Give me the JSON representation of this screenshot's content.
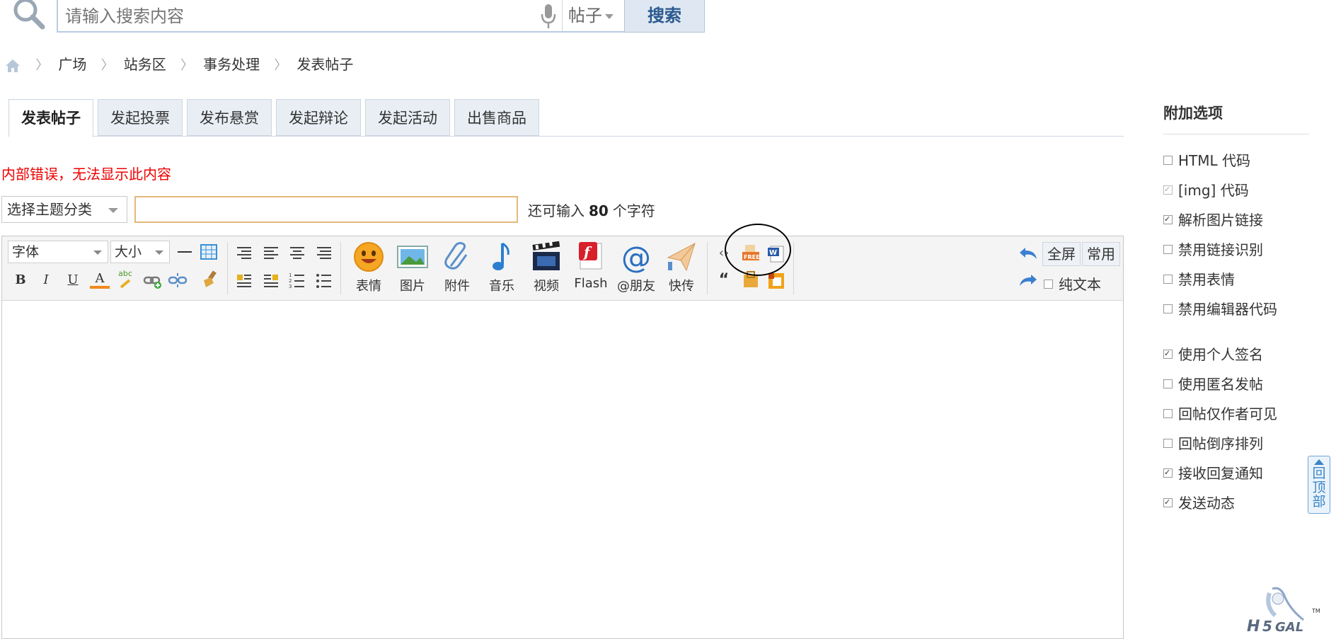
{
  "search": {
    "placeholder": "请输入搜索内容",
    "type": "帖子",
    "button_label": "搜索"
  },
  "breadcrumb": [
    "广场",
    "站务区",
    "事务处理",
    "发表帖子"
  ],
  "tabs": [
    {
      "label": "发表帖子",
      "active": true
    },
    {
      "label": "发起投票",
      "active": false
    },
    {
      "label": "发布悬赏",
      "active": false
    },
    {
      "label": "发起辩论",
      "active": false
    },
    {
      "label": "发起活动",
      "active": false
    },
    {
      "label": "出售商品",
      "active": false
    }
  ],
  "error_message": "内部错误，无法显示此内容",
  "subject": {
    "category_placeholder": "选择主题分类",
    "remaining_prefix": "还可输入",
    "remaining_count": "80",
    "remaining_suffix": "个字符"
  },
  "editor": {
    "font_select": "字体",
    "size_select": "大小",
    "format_buttons": {
      "bold": "B",
      "italic": "I",
      "underline": "U",
      "font_color": "A",
      "spellcheck": "abc"
    },
    "insert_buttons": [
      {
        "label": "表情",
        "icon": "smiley-icon"
      },
      {
        "label": "图片",
        "icon": "image-icon"
      },
      {
        "label": "附件",
        "icon": "paperclip-icon"
      },
      {
        "label": "音乐",
        "icon": "music-note-icon"
      },
      {
        "label": "视频",
        "icon": "video-clapper-icon"
      },
      {
        "label": "Flash",
        "icon": "flash-icon"
      },
      {
        "label": "@朋友",
        "icon": "at-icon"
      },
      {
        "label": "快传",
        "icon": "paper-plane-icon"
      }
    ],
    "fullscreen_label": "全屏",
    "common_label": "常用",
    "plain_text_label": "纯文本"
  },
  "sidebar": {
    "title": "附加选项",
    "options": [
      {
        "label": "HTML 代码",
        "checked": false,
        "disabled": false
      },
      {
        "label": "[img] 代码",
        "checked": true,
        "disabled": true
      },
      {
        "label": "解析图片链接",
        "checked": true,
        "disabled": false
      },
      {
        "label": "禁用链接识别",
        "checked": false,
        "disabled": false
      },
      {
        "label": "禁用表情",
        "checked": false,
        "disabled": false
      },
      {
        "label": "禁用编辑器代码",
        "checked": false,
        "disabled": false
      },
      {
        "label": "使用个人签名",
        "checked": true,
        "disabled": false
      },
      {
        "label": "使用匿名发帖",
        "checked": false,
        "disabled": false
      },
      {
        "label": "回帖仅作者可见",
        "checked": false,
        "disabled": false
      },
      {
        "label": "回帖倒序排列",
        "checked": false,
        "disabled": false
      },
      {
        "label": "接收回复通知",
        "checked": true,
        "disabled": false
      },
      {
        "label": "发送动态",
        "checked": true,
        "disabled": false
      }
    ]
  },
  "back_to_top": "回顶部",
  "colors": {
    "accent": "#2b5a8f",
    "error": "#ee0000",
    "tab_bg": "#e8eef4",
    "subject_border": "#e3b87d"
  }
}
